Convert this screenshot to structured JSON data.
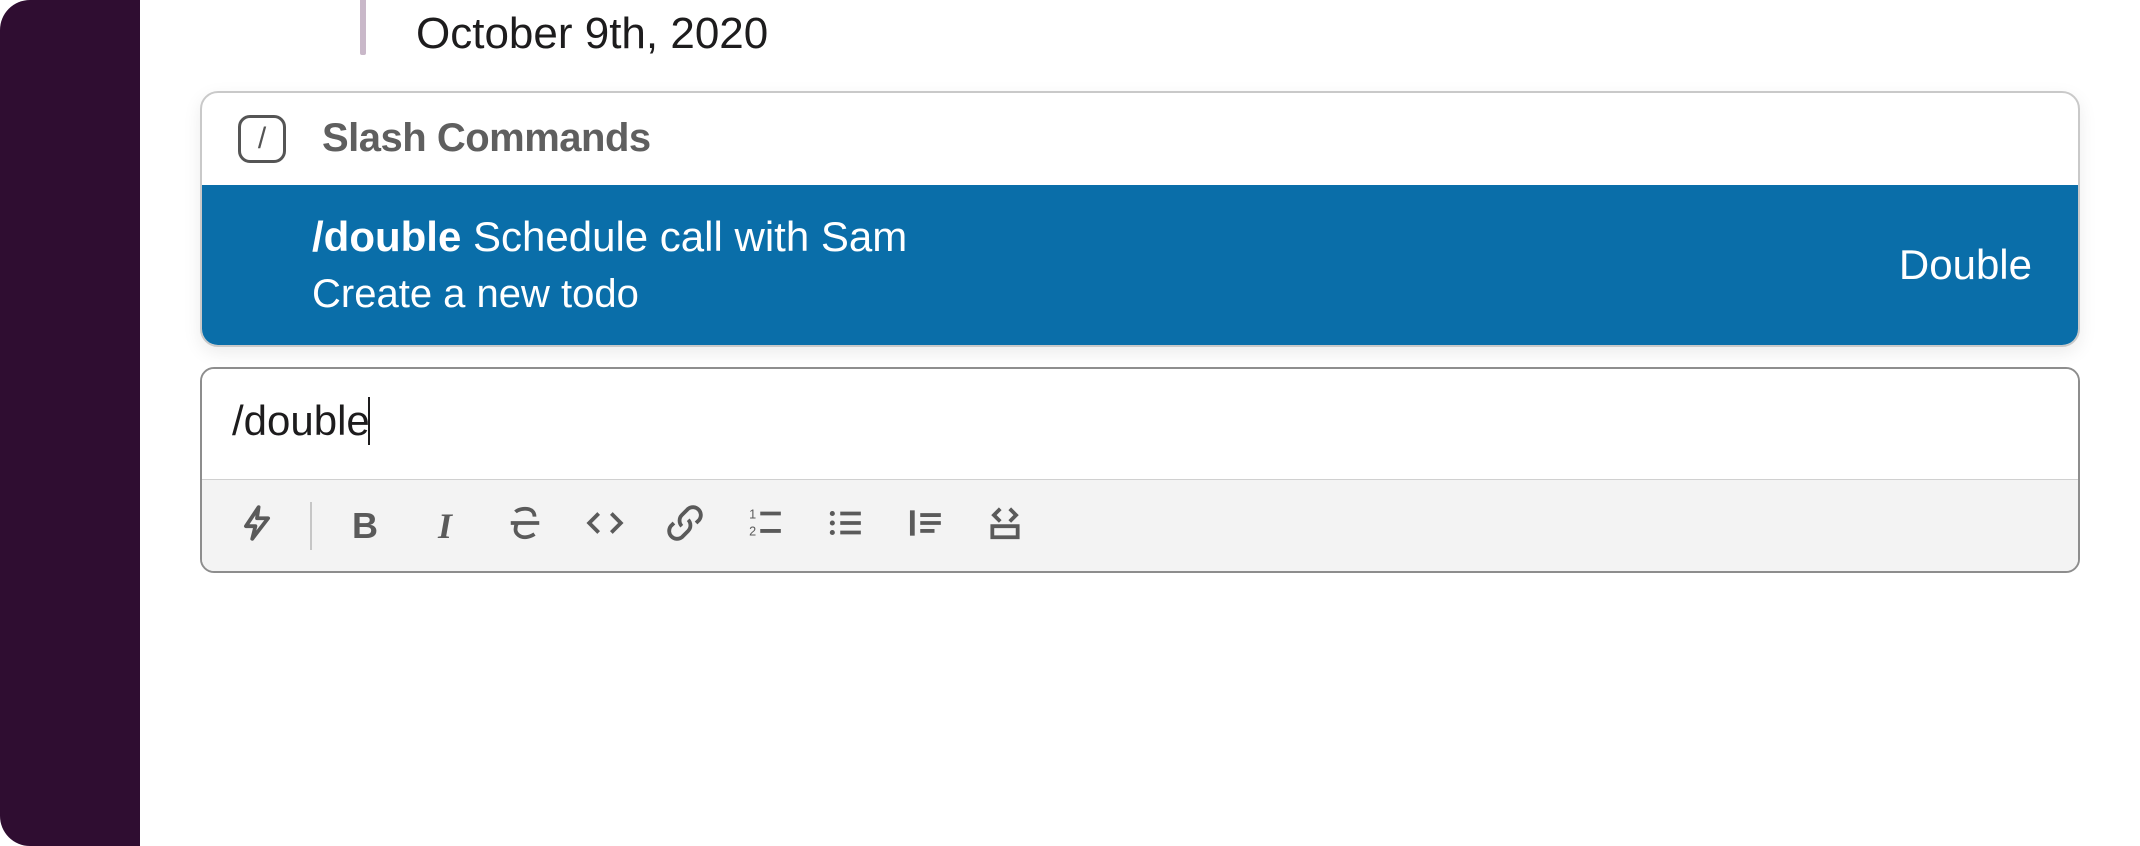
{
  "date_divider": {
    "label": "October 9th, 2020"
  },
  "suggest": {
    "header_label": "Slash Commands",
    "items": [
      {
        "command": "/double",
        "hint": "Schedule call with Sam",
        "description": "Create a new todo",
        "app_name": "Double"
      }
    ]
  },
  "composer": {
    "input_value": "/double",
    "toolbar": {
      "shortcuts_label": "Shortcuts",
      "bold_label": "B",
      "italic_label": "I",
      "strike_label": "Strikethrough",
      "code_label": "Code",
      "link_label": "Link",
      "olist_label": "Ordered list",
      "ulist_label": "Bulleted list",
      "quote_label": "Blockquote",
      "codeblock_label": "Code block"
    }
  },
  "colors": {
    "sidebar": "#2f0d31",
    "suggest_highlight": "#0a6ea9"
  }
}
